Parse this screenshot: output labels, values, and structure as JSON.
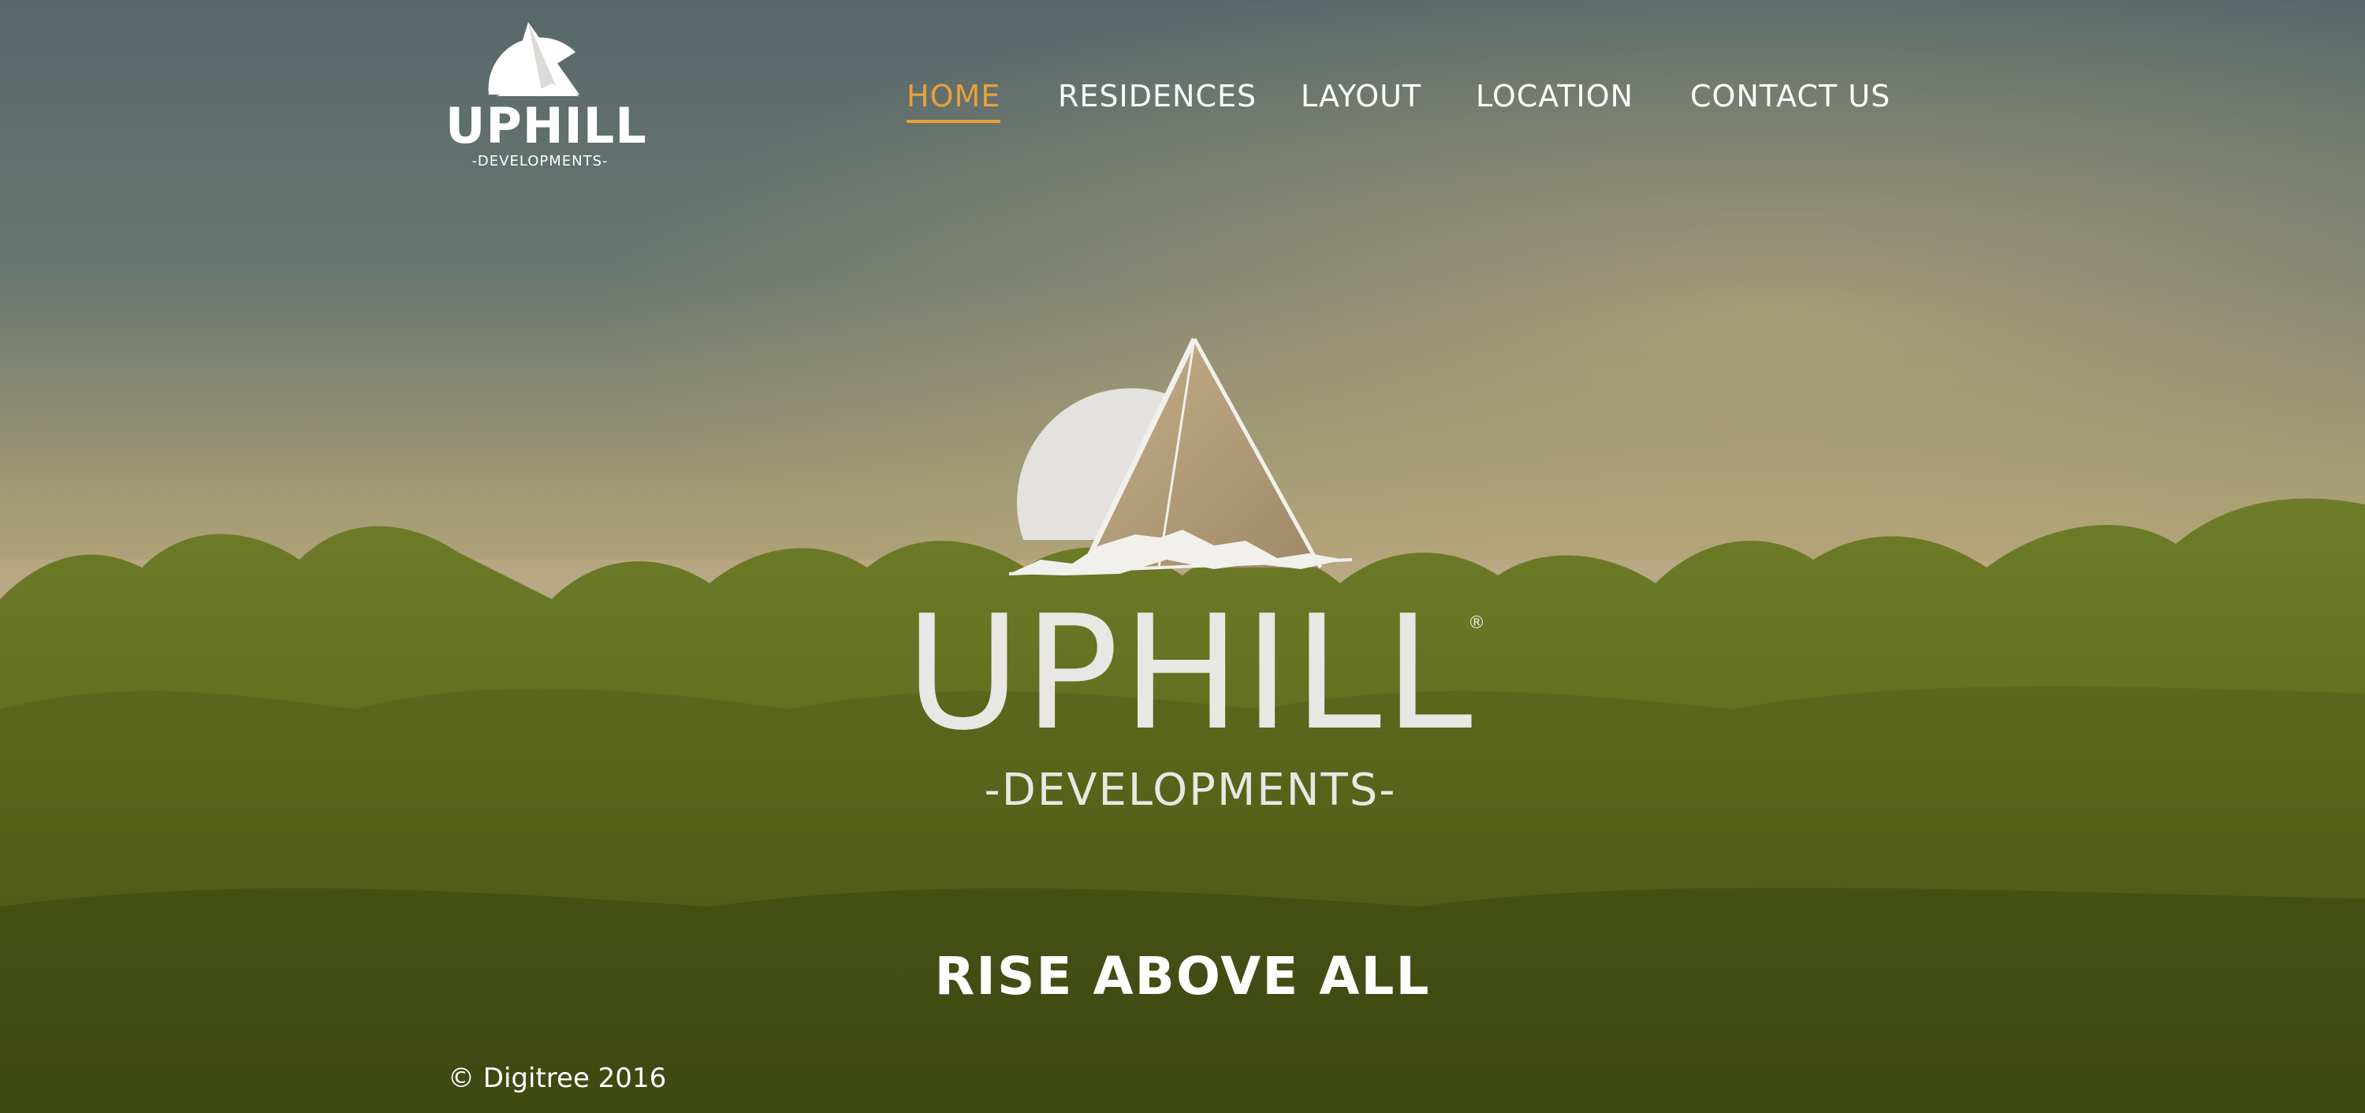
{
  "brand": {
    "name": "UPHILL",
    "sub": "-DEVELOPMENTS-",
    "registered": "®"
  },
  "nav": {
    "items": [
      {
        "label": "HOME",
        "active": true
      },
      {
        "label": "RESIDENCES",
        "active": false
      },
      {
        "label": "LAYOUT",
        "active": false
      },
      {
        "label": "LOCATION",
        "active": false
      },
      {
        "label": "CONTACT US",
        "active": false
      }
    ]
  },
  "hero": {
    "tagline": "RISE ABOVE ALL"
  },
  "footer": {
    "copyright": "© Digitree 2016"
  },
  "colors": {
    "accent": "#e8a13a",
    "text": "#ffffff",
    "sky_top": "#5a6a6a",
    "sky_bottom": "#b8a67a",
    "foliage": "#5f6e1e",
    "pyramid": "#b59d78",
    "moon": "#e4e2de"
  }
}
